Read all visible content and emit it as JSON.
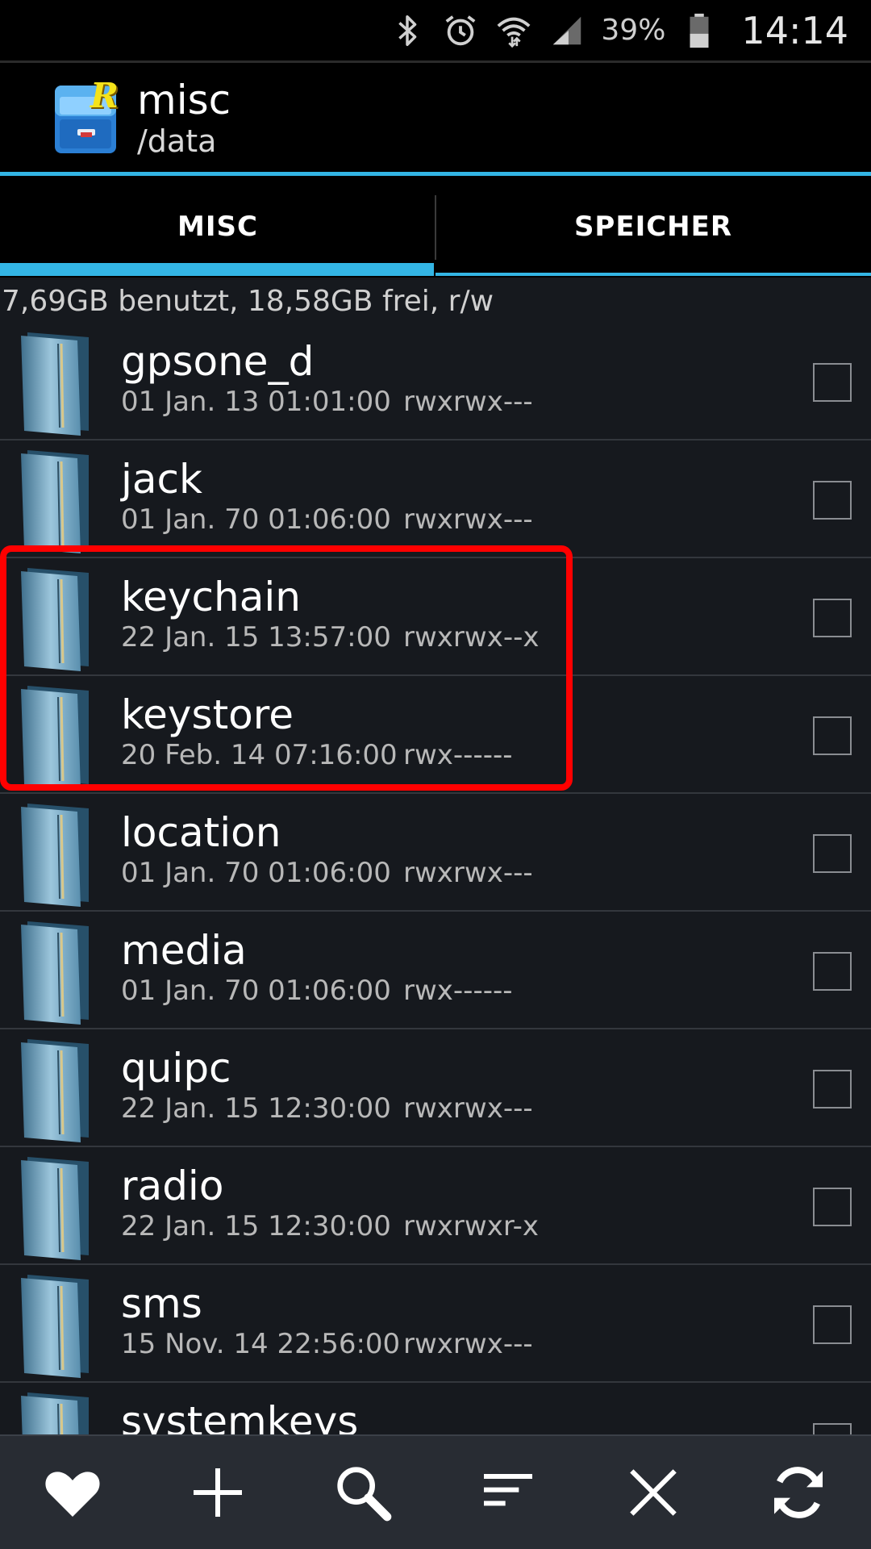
{
  "status_bar": {
    "battery_percent": "39%",
    "time": "14:14",
    "icons": [
      "bluetooth-icon",
      "alarm-icon",
      "wifi-icon",
      "signal-icon",
      "battery-icon"
    ]
  },
  "action_bar": {
    "title": "misc",
    "subtitle": "/data",
    "logo": "root-explorer-logo",
    "logo_letter": "R"
  },
  "tabs": [
    {
      "label": "MISC",
      "active": true
    },
    {
      "label": "SPEICHER",
      "active": false
    }
  ],
  "storage_info": "7,69GB benutzt, 18,58GB frei, r/w",
  "files": [
    {
      "name": "gpsone_d",
      "date": "01 Jan. 13 01:01:00",
      "permissions": "rwxrwx---"
    },
    {
      "name": "jack",
      "date": "01 Jan. 70 01:06:00",
      "permissions": "rwxrwx---"
    },
    {
      "name": "keychain",
      "date": "22 Jan. 15 13:57:00",
      "permissions": "rwxrwx--x"
    },
    {
      "name": "keystore",
      "date": "20 Feb. 14 07:16:00",
      "permissions": "rwx------"
    },
    {
      "name": "location",
      "date": "01 Jan. 70 01:06:00",
      "permissions": "rwxrwx---"
    },
    {
      "name": "media",
      "date": "01 Jan. 70 01:06:00",
      "permissions": "rwx------"
    },
    {
      "name": "quipc",
      "date": "22 Jan. 15 12:30:00",
      "permissions": "rwxrwx---"
    },
    {
      "name": "radio",
      "date": "22 Jan. 15 12:30:00",
      "permissions": "rwxrwxr-x"
    },
    {
      "name": "sms",
      "date": "15 Nov. 14 22:56:00",
      "permissions": "rwxrwx---"
    },
    {
      "name": "systemkeys",
      "date": "",
      "permissions": ""
    }
  ],
  "highlight": {
    "color": "#ff0000",
    "items": [
      "keychain",
      "keystore"
    ]
  },
  "toolbar": {
    "buttons": [
      "favorites-icon",
      "add-icon",
      "search-icon",
      "sort-icon",
      "close-icon",
      "refresh-icon"
    ]
  },
  "colors": {
    "accent": "#33b5e5",
    "background": "#16191e",
    "toolbar": "#282c33"
  }
}
